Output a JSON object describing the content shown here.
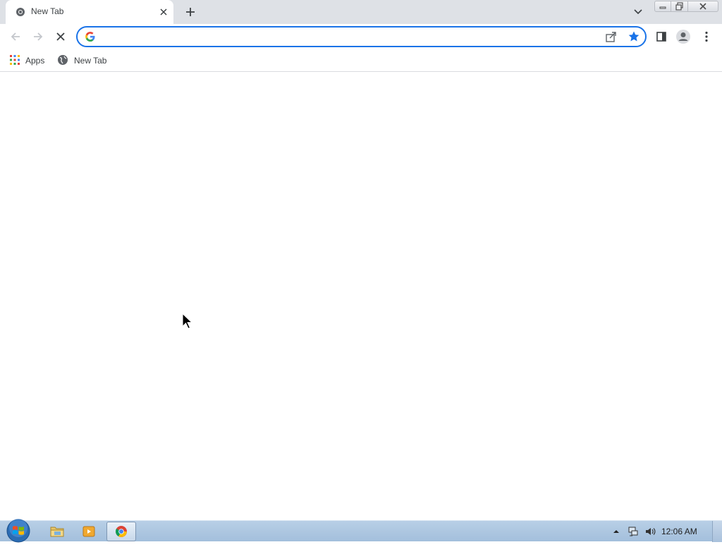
{
  "browser": {
    "tab": {
      "title": "New Tab",
      "favicon": "chrome-icon"
    },
    "new_tab_icon": "plus-icon",
    "tab_search_icon": "chevron-down-icon",
    "window_controls": [
      "minimize-icon",
      "maximize-icon",
      "close-icon"
    ],
    "toolbar": {
      "back_icon": "back-arrow-icon",
      "forward_icon": "forward-arrow-icon",
      "stop_icon": "stop-loading-icon",
      "omnibox": {
        "value": "",
        "placeholder": "",
        "left_icon": "google-g-icon",
        "share_icon": "share-icon",
        "bookmark_icon": "star-filled-icon"
      },
      "side_panel_icon": "side-panel-icon",
      "profile_icon": "profile-icon",
      "menu_icon": "kebab-menu-icon"
    },
    "bookmarks": [
      {
        "label": "Apps",
        "icon": "apps-grid-icon"
      },
      {
        "label": "New Tab",
        "icon": "globe-icon"
      }
    ]
  },
  "taskbar": {
    "start_icon": "windows-start-icon",
    "apps": [
      {
        "name": "File Explorer",
        "icon": "folder-icon",
        "active": false
      },
      {
        "name": "Media Player",
        "icon": "media-player-icon",
        "active": false
      },
      {
        "name": "Chrome",
        "icon": "chrome-icon",
        "active": true
      }
    ],
    "tray": [
      "tray-up-arrow-icon",
      "network-icon",
      "volume-icon"
    ],
    "clock": "12:06 AM"
  },
  "colors": {
    "tabstrip": "#dee1e6",
    "accent": "#1a73e8",
    "taskbar": "#a3bfdc"
  }
}
